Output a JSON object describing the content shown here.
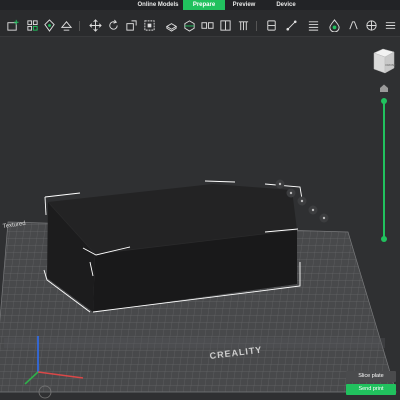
{
  "tabs": [
    {
      "label": "Online Models",
      "active": false
    },
    {
      "label": "Prepare",
      "active": true
    },
    {
      "label": "Preview",
      "active": false
    },
    {
      "label": "Device",
      "active": false
    }
  ],
  "toolbar_icons": [
    "add-model-icon",
    "arrange-icon",
    "orient-icon",
    "auto-orient-icon",
    "move-icon",
    "rotate-icon",
    "scale-icon",
    "bounding-box-icon",
    "lay-on-face-icon",
    "cut-icon",
    "split-objects-icon",
    "split-parts-icon",
    "support-paint-icon",
    "seam-paint-icon",
    "measure-icon",
    "text-icon",
    "color-paint-icon",
    "variable-layer-icon",
    "assembly-icon",
    "more-icon"
  ],
  "plate": {
    "brand": "CREALITY",
    "corner_label": "Textured"
  },
  "navcube_face": "FRONT",
  "buttons": {
    "slice": "Slice plate",
    "send": "Send print"
  },
  "colors": {
    "accent": "#21c15e",
    "model": "#1b1b1c",
    "bed": "#4a4b4d"
  }
}
